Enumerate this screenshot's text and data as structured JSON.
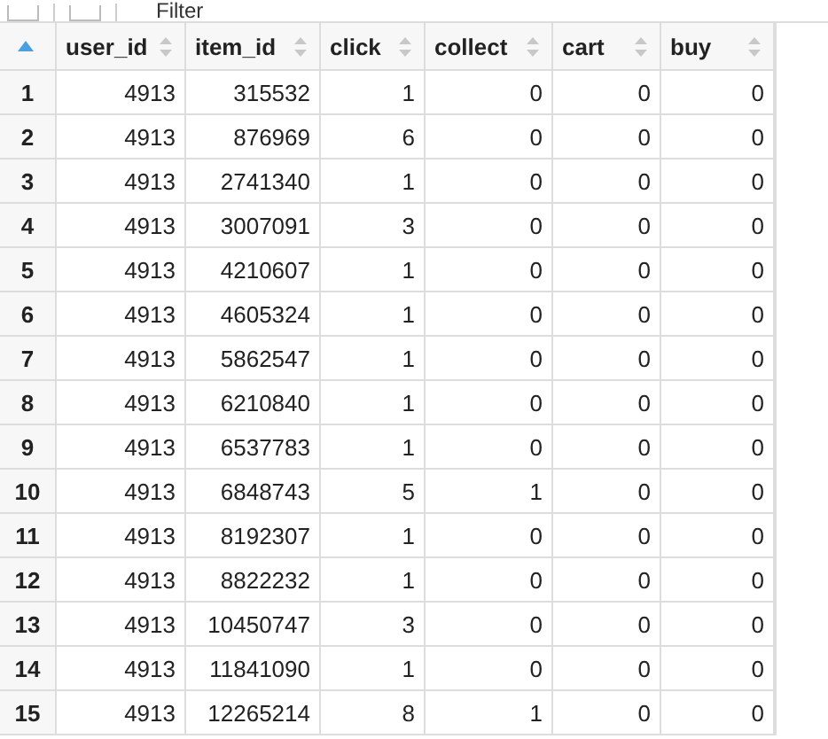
{
  "toolbar": {
    "filter_label": "Filter"
  },
  "table": {
    "index_sorted": true,
    "columns": [
      "user_id",
      "item_id",
      "click",
      "collect",
      "cart",
      "buy"
    ],
    "rows": [
      {
        "number": "1",
        "cells": [
          "4913",
          "315532",
          "1",
          "0",
          "0",
          "0"
        ]
      },
      {
        "number": "2",
        "cells": [
          "4913",
          "876969",
          "6",
          "0",
          "0",
          "0"
        ]
      },
      {
        "number": "3",
        "cells": [
          "4913",
          "2741340",
          "1",
          "0",
          "0",
          "0"
        ]
      },
      {
        "number": "4",
        "cells": [
          "4913",
          "3007091",
          "3",
          "0",
          "0",
          "0"
        ]
      },
      {
        "number": "5",
        "cells": [
          "4913",
          "4210607",
          "1",
          "0",
          "0",
          "0"
        ]
      },
      {
        "number": "6",
        "cells": [
          "4913",
          "4605324",
          "1",
          "0",
          "0",
          "0"
        ]
      },
      {
        "number": "7",
        "cells": [
          "4913",
          "5862547",
          "1",
          "0",
          "0",
          "0"
        ]
      },
      {
        "number": "8",
        "cells": [
          "4913",
          "6210840",
          "1",
          "0",
          "0",
          "0"
        ]
      },
      {
        "number": "9",
        "cells": [
          "4913",
          "6537783",
          "1",
          "0",
          "0",
          "0"
        ]
      },
      {
        "number": "10",
        "cells": [
          "4913",
          "6848743",
          "5",
          "1",
          "0",
          "0"
        ]
      },
      {
        "number": "11",
        "cells": [
          "4913",
          "8192307",
          "1",
          "0",
          "0",
          "0"
        ]
      },
      {
        "number": "12",
        "cells": [
          "4913",
          "8822232",
          "1",
          "0",
          "0",
          "0"
        ]
      },
      {
        "number": "13",
        "cells": [
          "4913",
          "10450747",
          "3",
          "0",
          "0",
          "0"
        ]
      },
      {
        "number": "14",
        "cells": [
          "4913",
          "11841090",
          "1",
          "0",
          "0",
          "0"
        ]
      },
      {
        "number": "15",
        "cells": [
          "4913",
          "12265214",
          "8",
          "1",
          "0",
          "0"
        ]
      }
    ]
  }
}
